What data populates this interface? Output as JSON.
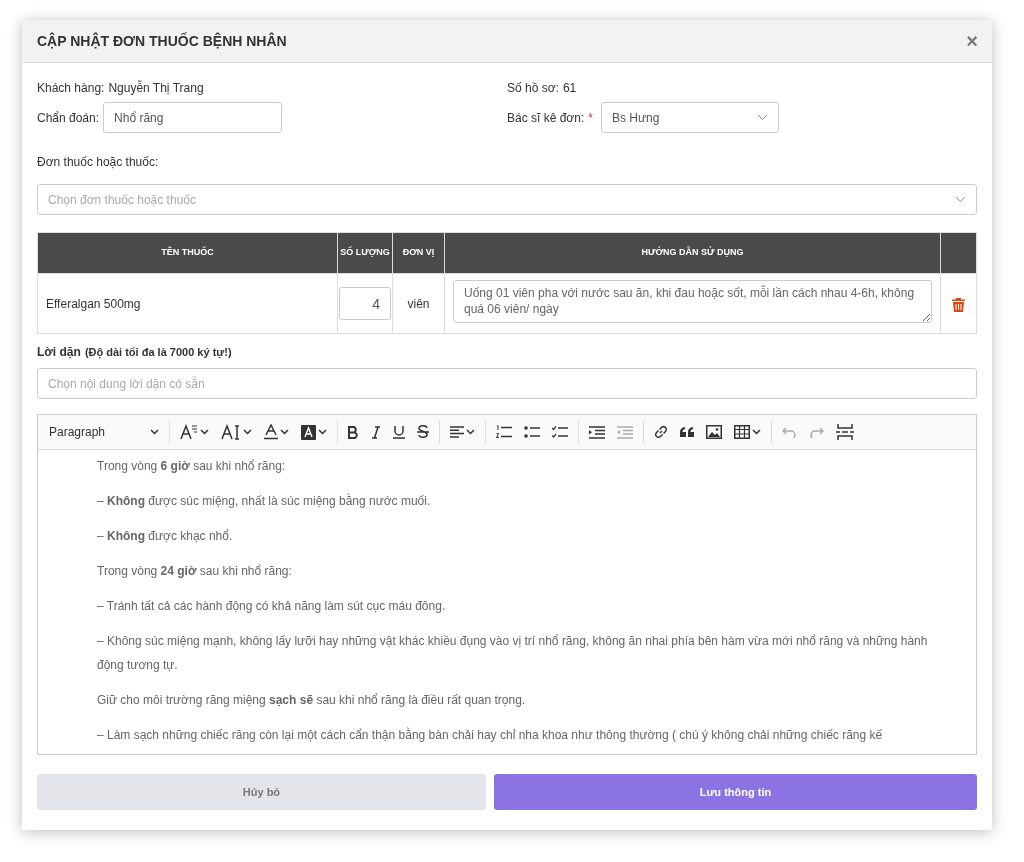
{
  "modal": {
    "title": "CẬP NHẬT ĐƠN THUỐC BỆNH NHÂN",
    "close": "×"
  },
  "patient": {
    "customer_label": "Khách hàng:",
    "customer": "Nguyễn Thị Trang",
    "record_label": "Số hồ sơ:",
    "record": "61",
    "diagnosis_label": "Chẩn đoán:",
    "diagnosis": "Nhổ răng",
    "doctor_label": "Bác sĩ kê đơn:",
    "doctor_required": true,
    "required_mark": "*",
    "doctor": "Bs Hưng"
  },
  "prescription": {
    "label": "Đơn thuốc hoặc thuốc:",
    "placeholder": "Chọn đơn thuốc hoặc thuốc"
  },
  "table": {
    "columns": [
      "TÊN THUỐC",
      "SỐ LƯỢNG",
      "ĐƠN VỊ",
      "HƯỚNG DẪN SỬ DỤNG"
    ],
    "rows": [
      {
        "name": "Efferalgan 500mg",
        "quantity": "4",
        "unit": "viên",
        "instructions": "Uống 01 viên pha với nước sau ăn, khi đau hoặc sốt, mỗi lần cách nhau 4-6h, không quá 06 viên/ ngày"
      }
    ]
  },
  "advice": {
    "label": "Lời dặn",
    "hint": "(Độ dài tối đa là 7000 ký tự!)",
    "placeholder": "Chọn nội dung lời dặn có sẵn"
  },
  "editor": {
    "block_style": "Paragraph",
    "toolbar": [
      {
        "kind": "font-size",
        "disabled": false
      },
      {
        "kind": "font-family",
        "disabled": false
      },
      {
        "kind": "font-color",
        "disabled": false
      },
      {
        "kind": "highlight",
        "disabled": false
      },
      {
        "kind": "separator"
      },
      {
        "kind": "bold",
        "disabled": false
      },
      {
        "kind": "italic",
        "disabled": false
      },
      {
        "kind": "underline",
        "disabled": false
      },
      {
        "kind": "strike",
        "disabled": false
      },
      {
        "kind": "separator"
      },
      {
        "kind": "align",
        "disabled": false
      },
      {
        "kind": "separator"
      },
      {
        "kind": "numbered-list",
        "disabled": false
      },
      {
        "kind": "bullet-list",
        "disabled": false
      },
      {
        "kind": "todo-list",
        "disabled": false
      },
      {
        "kind": "separator"
      },
      {
        "kind": "indent",
        "disabled": false
      },
      {
        "kind": "outdent",
        "disabled": true
      },
      {
        "kind": "separator"
      },
      {
        "kind": "link",
        "disabled": false
      },
      {
        "kind": "quote",
        "disabled": false
      },
      {
        "kind": "image",
        "disabled": false
      },
      {
        "kind": "table",
        "disabled": false
      },
      {
        "kind": "separator"
      },
      {
        "kind": "undo",
        "disabled": true
      },
      {
        "kind": "redo",
        "disabled": true
      },
      {
        "kind": "page-break",
        "disabled": false
      }
    ],
    "paragraphs": [
      "Trong vòng **6 giờ** sau khi nhổ răng:",
      "– **Không** được súc miệng, nhất là súc miệng bằng nước muối.",
      "– **Không** được khạc nhổ.",
      "Trong vòng **24 giờ** sau khi nhổ răng:",
      "– Tránh tất cả các hành động có khả năng làm sút cục máu đông.",
      "– Không súc miệng mạnh, không lấy lưỡi hay những vật khác khiều đụng vào vị trí nhổ răng, không ăn nhai phía bên hàm vừa mới nhổ răng và những hành động tương tự.",
      "Giữ cho môi trường răng miệng **sạch sẽ** sau khi nhổ răng là điều rất quan trọng.",
      "– Làm sạch những chiếc răng còn lại  một cách cẩn thận bằng bàn chải hay chỉ nha khoa như thông thường ( chú ý không chải những chiếc răng kế"
    ]
  },
  "buttons": {
    "cancel": "Hủy bỏ",
    "save": "Lưu thông tin"
  }
}
